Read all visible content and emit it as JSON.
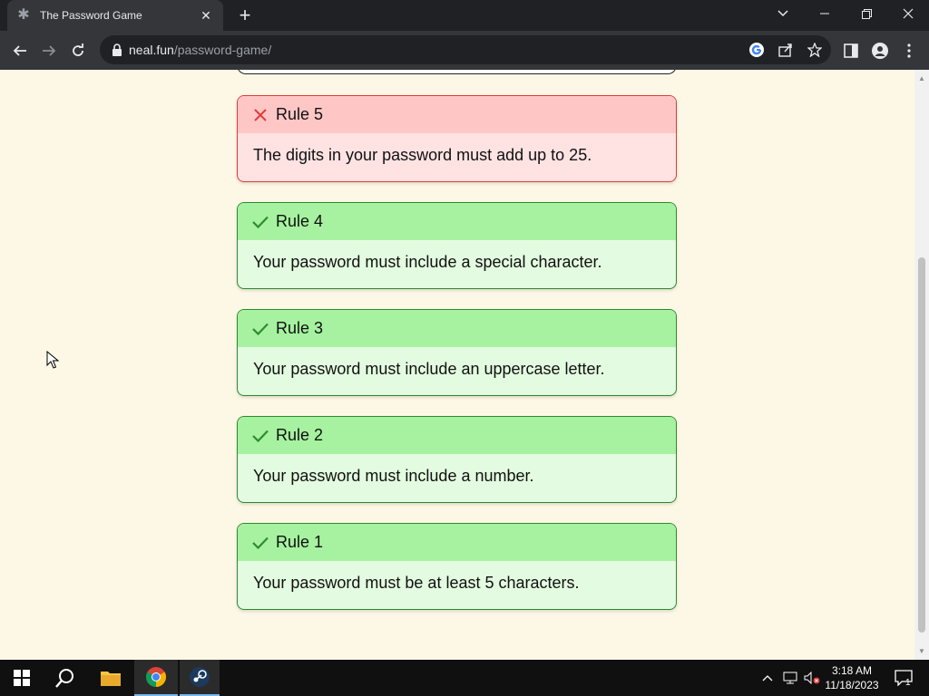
{
  "browser": {
    "tab_title": "The Password Game",
    "url_host": "neal.fun",
    "url_path": "/password-game/"
  },
  "rules": [
    {
      "name": "Rule 5",
      "text": "The digits in your password must add up to 25.",
      "status": "fail"
    },
    {
      "name": "Rule 4",
      "text": "Your password must include a special character.",
      "status": "pass"
    },
    {
      "name": "Rule 3",
      "text": "Your password must include an uppercase letter.",
      "status": "pass"
    },
    {
      "name": "Rule 2",
      "text": "Your password must include a number.",
      "status": "pass"
    },
    {
      "name": "Rule 1",
      "text": "Your password must be at least 5 characters.",
      "status": "pass"
    }
  ],
  "colors": {
    "page_bg": "#fdf8e6",
    "pass_header": "#a6f2a0",
    "pass_body": "#e3fbe0",
    "fail_header": "#ffc6c6",
    "fail_body": "#ffe3e3",
    "fail_icon": "#e23a3a",
    "pass_icon": "#2e8b2e"
  },
  "taskbar": {
    "time": "3:18 AM",
    "date": "11/18/2023",
    "notification_count": "1"
  }
}
